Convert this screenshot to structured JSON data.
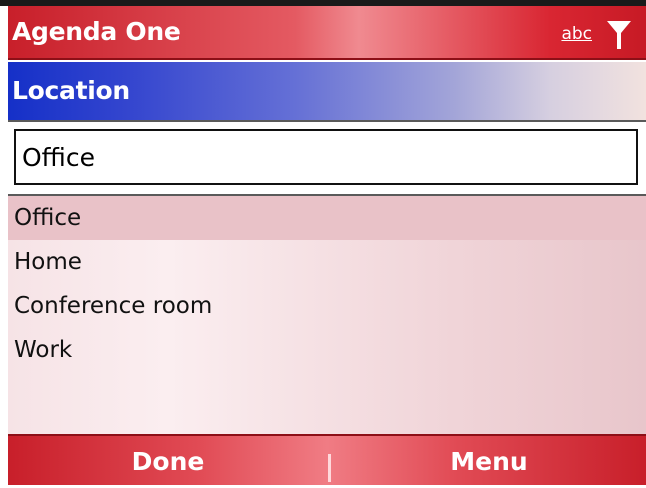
{
  "title_bar": {
    "app_name": "Agenda One",
    "input_mode": "abc",
    "signal_icon": "antenna-signal-icon"
  },
  "section": {
    "title": "Location"
  },
  "location_input": {
    "value": "Office"
  },
  "suggestions": {
    "items": [
      "Office",
      "Home",
      "Conference room",
      "Work"
    ],
    "selected_index": 0
  },
  "softkeys": {
    "left": "Done",
    "right": "Menu"
  },
  "colors": {
    "title_red": "#c81f2a",
    "header_blue": "#1530c8",
    "selection": "#e9c2c8"
  }
}
